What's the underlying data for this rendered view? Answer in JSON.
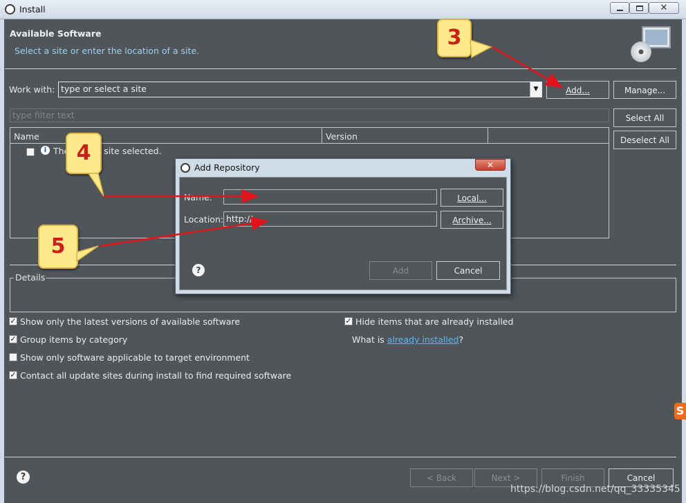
{
  "window": {
    "title": "Install"
  },
  "header": {
    "title": "Available Software",
    "subtitle": "Select a site or enter the location of a site."
  },
  "work_with": {
    "label": "Work with:",
    "value": "type or select a site",
    "add_label": "Add...",
    "manage_label": "Manage..."
  },
  "filter": {
    "placeholder": "type filter text"
  },
  "side_buttons": {
    "select_all": "Select All",
    "deselect_all": "Deselect All"
  },
  "table": {
    "columns": [
      "Name",
      "Version"
    ],
    "row_text": "There is no site selected."
  },
  "details": {
    "label": "Details"
  },
  "options": {
    "latest_versions": {
      "label": "Show only the latest versions of available software",
      "checked": true
    },
    "group_by_category": {
      "label": "Group items by category",
      "checked": true
    },
    "target_env": {
      "label": "Show only software applicable to target environment",
      "checked": false
    },
    "contact_sites": {
      "label": "Contact all update sites during install to find required software",
      "checked": true
    },
    "hide_installed": {
      "label": "Hide items that are already installed",
      "checked": true
    },
    "what_is": {
      "prefix": "What is ",
      "link": "already installed",
      "suffix": "?"
    }
  },
  "footer": {
    "back": "< Back",
    "next": "Next >",
    "finish": "Finish",
    "cancel": "Cancel",
    "watermark": "https://blog.csdn.net/qq_33335345"
  },
  "dialog": {
    "title": "Add Repository",
    "name_label": "Name:",
    "name_value": "",
    "location_label": "Location:",
    "location_value": "http://",
    "local_label": "Local...",
    "archive_label": "Archive...",
    "add_label": "Add",
    "cancel_label": "Cancel"
  },
  "callouts": {
    "c3": "3",
    "c4": "4",
    "c5": "5"
  },
  "colors": {
    "background": "#4f5559",
    "titlebar": "#dfe8f1",
    "arrow": "#e0141a",
    "link": "#5db6f0",
    "callout": "#fde98a"
  }
}
